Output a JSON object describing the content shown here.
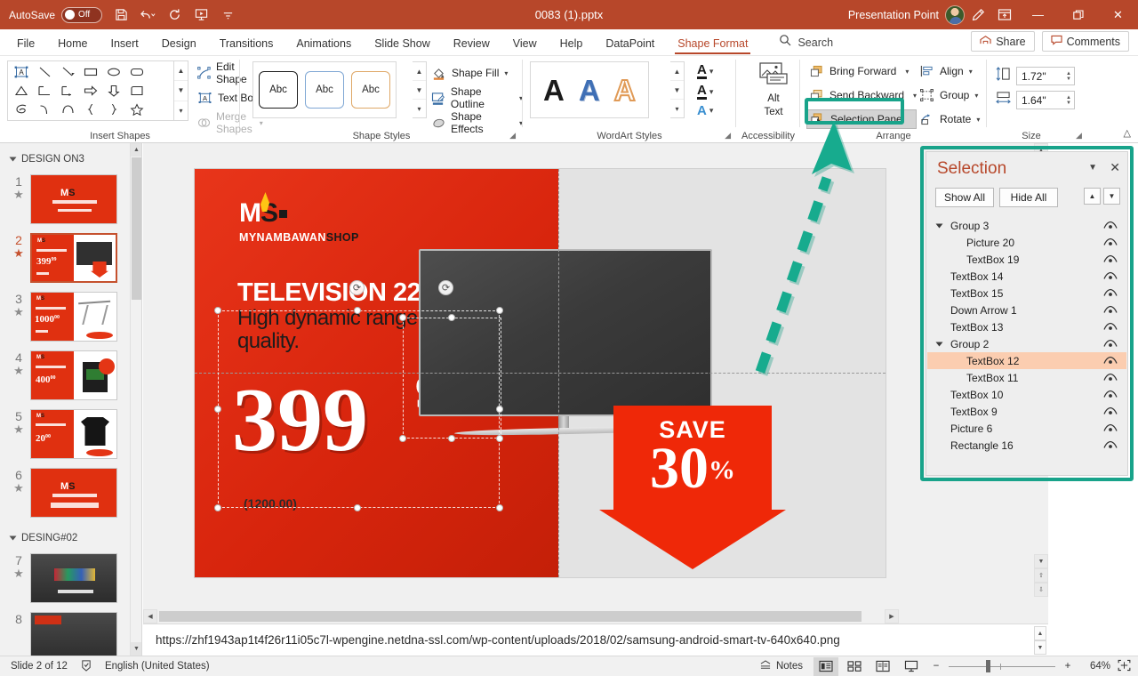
{
  "titlebar": {
    "autosave_label": "AutoSave",
    "autosave_state": "Off",
    "save_icon": "save-icon",
    "undo_icon": "undo-icon",
    "redo_icon": "redo-icon",
    "present_icon": "start-presentation-icon",
    "more_icon": "customize-qat-icon",
    "document_title": "0083 (1).pptx",
    "user_name": "Presentation Point",
    "pen_icon": "ink-pen-icon",
    "ribbon_display_icon": "ribbon-display-options-icon",
    "minimize": "—",
    "restore": "❐",
    "close": "✕"
  },
  "tabs": [
    {
      "label": "File",
      "active": false
    },
    {
      "label": "Home",
      "active": false
    },
    {
      "label": "Insert",
      "active": false
    },
    {
      "label": "Design",
      "active": false
    },
    {
      "label": "Transitions",
      "active": false
    },
    {
      "label": "Animations",
      "active": false
    },
    {
      "label": "Slide Show",
      "active": false
    },
    {
      "label": "Review",
      "active": false
    },
    {
      "label": "View",
      "active": false
    },
    {
      "label": "Help",
      "active": false
    },
    {
      "label": "DataPoint",
      "active": false
    },
    {
      "label": "Shape Format",
      "active": true
    }
  ],
  "search": {
    "placeholder": "Search",
    "label": "Search"
  },
  "ribbon_right": {
    "share_label": "Share",
    "comments_label": "Comments"
  },
  "ribbon": {
    "groups": [
      {
        "name": "Insert Shapes",
        "title": "Insert Shapes"
      },
      {
        "name": "Shape Styles",
        "title": "Shape Styles"
      },
      {
        "name": "WordArt Styles",
        "title": "WordArt Styles"
      },
      {
        "name": "Accessibility",
        "title": "Accessibility"
      },
      {
        "name": "Arrange",
        "title": "Arrange"
      },
      {
        "name": "Size",
        "title": "Size"
      }
    ],
    "insert_shapes": {
      "edit_shape": "Edit Shape",
      "text_box": "Text Box",
      "merge_shapes": "Merge Shapes"
    },
    "shape_styles": {
      "chips": [
        "Abc",
        "Abc",
        "Abc"
      ],
      "shape_fill": "Shape Fill",
      "shape_outline": "Shape Outline",
      "shape_effects": "Shape Effects"
    },
    "wordart_styles": {
      "samples": [
        "A",
        "A",
        "A"
      ]
    },
    "accessibility": {
      "alt_text_line1": "Alt",
      "alt_text_line2": "Text"
    },
    "arrange": {
      "bring_forward": "Bring Forward",
      "send_backward": "Send Backward",
      "selection_pane": "Selection Pane",
      "align": "Align",
      "group": "Group",
      "rotate": "Rotate"
    },
    "size": {
      "height": "1.72\"",
      "width": "1.64\""
    }
  },
  "thumbnails": {
    "sections": [
      {
        "name": "DESIGN ON3",
        "slides": [
          {
            "number": "1",
            "selected": false,
            "kind": "logo"
          },
          {
            "number": "2",
            "selected": true,
            "kind": "tv"
          },
          {
            "number": "3",
            "selected": false,
            "kind": "board"
          },
          {
            "number": "4",
            "selected": false,
            "kind": "pc"
          },
          {
            "number": "5",
            "selected": false,
            "kind": "shirt"
          },
          {
            "number": "6",
            "selected": false,
            "kind": "logo"
          }
        ]
      },
      {
        "name": "DESING#02",
        "slides": [
          {
            "number": "7",
            "selected": false,
            "kind": "dark"
          },
          {
            "number": "8",
            "selected": false,
            "kind": "dark"
          }
        ]
      }
    ]
  },
  "slide": {
    "brand_main": "M",
    "brand_s": "S",
    "brand_sub_1": "MYNAMBAWAN",
    "brand_sub_2": "SHOP",
    "headline": "TELEVISION 22”",
    "subhead": "High dynamic range. Amazing quality.",
    "price_main": "399",
    "price_cents": "99",
    "price_old": "(1200.00)",
    "save_word": "SAVE",
    "save_number": "30",
    "save_percent": "%"
  },
  "selection_pane": {
    "title": "Selection",
    "show_all": "Show All",
    "hide_all": "Hide All",
    "close_icon": "close-icon",
    "menu_icon": "pane-options-icon",
    "reorder_up_icon": "bring-forward-icon",
    "reorder_down_icon": "send-backward-icon",
    "items": [
      {
        "label": "Group 3",
        "indent": 0,
        "group": true,
        "selected": false
      },
      {
        "label": "Picture 20",
        "indent": 1,
        "group": false,
        "selected": false
      },
      {
        "label": "TextBox 19",
        "indent": 1,
        "group": false,
        "selected": false
      },
      {
        "label": "TextBox 14",
        "indent": 0,
        "group": false,
        "selected": false
      },
      {
        "label": "TextBox 15",
        "indent": 0,
        "group": false,
        "selected": false
      },
      {
        "label": "Down Arrow 1",
        "indent": 0,
        "group": false,
        "selected": false
      },
      {
        "label": "TextBox 13",
        "indent": 0,
        "group": false,
        "selected": false
      },
      {
        "label": "Group 2",
        "indent": 0,
        "group": true,
        "selected": false
      },
      {
        "label": "TextBox 12",
        "indent": 1,
        "group": false,
        "selected": true
      },
      {
        "label": "TextBox 11",
        "indent": 1,
        "group": false,
        "selected": false
      },
      {
        "label": "TextBox 10",
        "indent": 0,
        "group": false,
        "selected": false
      },
      {
        "label": "TextBox 9",
        "indent": 0,
        "group": false,
        "selected": false
      },
      {
        "label": "Picture 6",
        "indent": 0,
        "group": false,
        "selected": false
      },
      {
        "label": "Rectangle 16",
        "indent": 0,
        "group": false,
        "selected": false
      }
    ]
  },
  "url_bar": {
    "url": "https://zhf1943ap1t4f26r11i05c7l-wpengine.netdna-ssl.com/wp-content/uploads/2018/02/samsung-android-smart-tv-640x640.png"
  },
  "statusbar": {
    "slide_counter": "Slide 2 of 12",
    "spellcheck_icon": "spellcheck-icon",
    "language": "English (United States)",
    "notes_label": "Notes",
    "view_normal_icon": "normal-view-icon",
    "view_sorter_icon": "slide-sorter-icon",
    "view_reading_icon": "reading-view-icon",
    "view_slideshow_icon": "slideshow-icon",
    "zoom_out": "−",
    "zoom_in": "+",
    "zoom_level": "64%",
    "fit_icon": "fit-slide-icon"
  },
  "annotation": {
    "highlight_color": "#18a38a",
    "target": "Selection Pane",
    "arrow": "dashed-arrow-annotation"
  }
}
